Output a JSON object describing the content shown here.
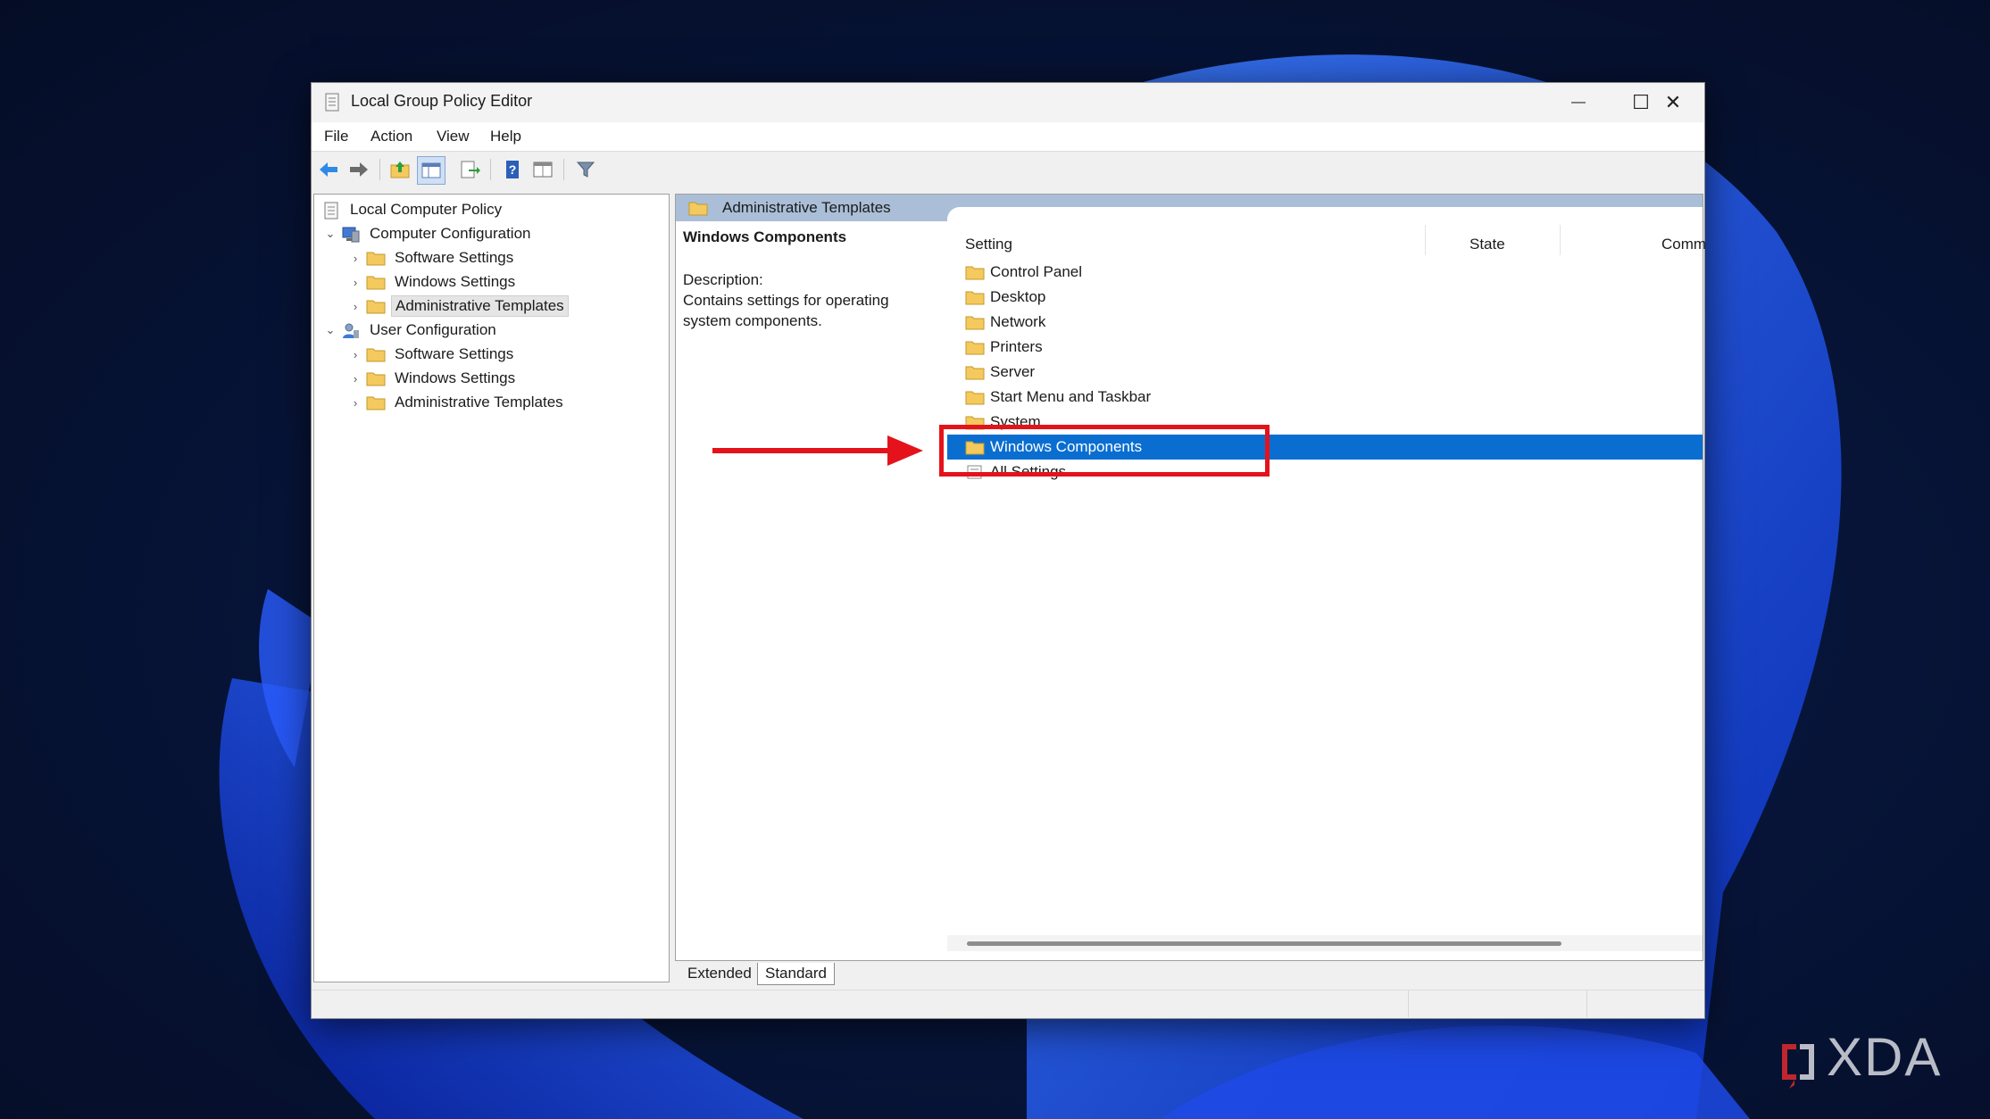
{
  "window": {
    "title": "Local Group Policy Editor",
    "minimize_glyph": "—",
    "maximize_glyph": "☐",
    "close_glyph": "✕"
  },
  "menu": [
    "File",
    "Action",
    "View",
    "Help"
  ],
  "toolbar": {
    "icons": [
      "back-arrow-icon",
      "forward-arrow-icon",
      "up-folder-icon",
      "show-hide-tree-icon",
      "export-list-icon",
      "help-icon",
      "properties-icon",
      "filter-icon"
    ]
  },
  "tree": {
    "root": "Local Computer Policy",
    "computer_config": "Computer Configuration",
    "cc_software": "Software Settings",
    "cc_windows": "Windows Settings",
    "cc_admin": "Administrative Templates",
    "user_config": "User Configuration",
    "uc_software": "Software Settings",
    "uc_windows": "Windows Settings",
    "uc_admin": "Administrative Templates"
  },
  "right": {
    "header": "Administrative Templates",
    "desc_title": "Windows Components",
    "desc_label": "Description:",
    "desc_line1": "Contains settings for operating",
    "desc_line2": "system components.",
    "col_setting": "Setting",
    "col_state": "State",
    "col_comment": "Comm",
    "items": [
      "Control Panel",
      "Desktop",
      "Network",
      "Printers",
      "Server",
      "Start Menu and Taskbar",
      "System",
      "Windows Components",
      "All Settings"
    ],
    "selected_index": 7
  },
  "tabs": [
    "Extended",
    "Standard"
  ],
  "brand": "XDA",
  "colors": {
    "selection": "#0a6ed1",
    "header_bar": "#aabed7",
    "callout": "#e4131b",
    "folder": "#f4c95d"
  }
}
